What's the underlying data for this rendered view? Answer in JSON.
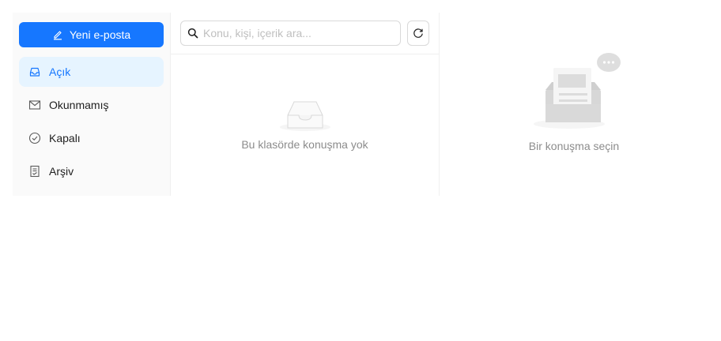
{
  "sidebar": {
    "compose": {
      "label": "Yeni e-posta",
      "icon": "edit-icon"
    },
    "items": [
      {
        "label": "Açık",
        "icon": "inbox-icon",
        "active": true
      },
      {
        "label": "Okunmamış",
        "icon": "mail-icon",
        "active": false
      },
      {
        "label": "Kapalı",
        "icon": "check-circle-icon",
        "active": false
      },
      {
        "label": "Arşiv",
        "icon": "archive-icon",
        "active": false
      }
    ]
  },
  "list": {
    "search": {
      "placeholder": "Konu, kişi, içerik ara...",
      "value": "",
      "icon": "search-icon"
    },
    "refresh_icon": "refresh-icon",
    "empty_text": "Bu klasörde konuşma yok"
  },
  "detail": {
    "empty_text": "Bir konuşma seçin"
  },
  "colors": {
    "primary": "#1677ff",
    "active_bg": "#e6f4ff",
    "muted_text": "#8c8c8c",
    "border": "#d9d9d9"
  }
}
